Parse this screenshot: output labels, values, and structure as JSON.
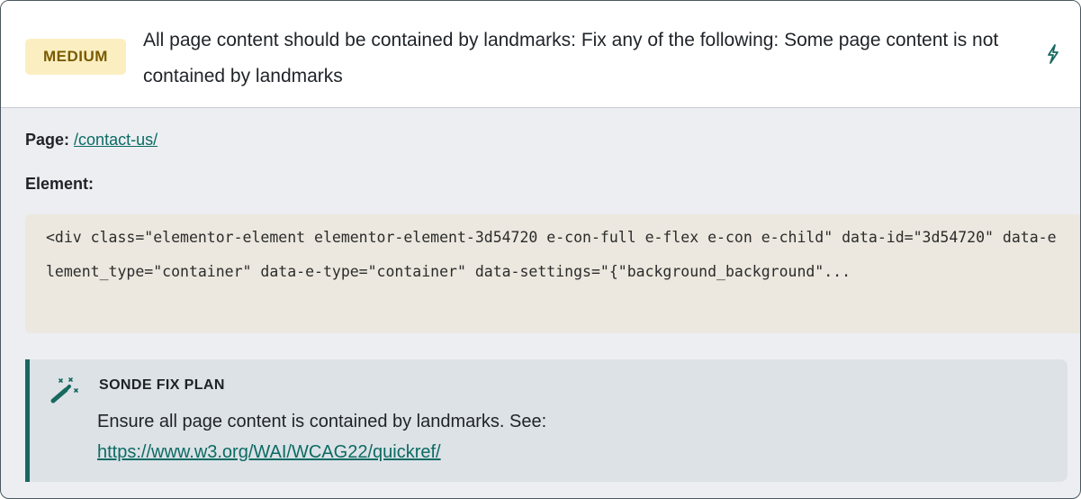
{
  "issue": {
    "severity": "MEDIUM",
    "title": "All page content should be contained by landmarks: Fix any of the following: Some page content is not contained by landmarks",
    "page_label": "Page:",
    "page_link": "/contact-us/",
    "element_label": "Element:",
    "element_code": "<div class=\"elementor-element elementor-element-3d54720 e-con-full e-flex e-con e-child\" data-id=\"3d54720\" data-element_type=\"container\" data-e-type=\"container\" data-settings=\"{\"background_background\"...",
    "fix_plan": {
      "title": "SONDE FIX PLAN",
      "text": "Ensure all page content is contained by landmarks. See:",
      "link": "https://www.w3.org/WAI/WCAG22/quickref/"
    }
  },
  "colors": {
    "accent": "#17695f",
    "badge_bg": "#fbefc2",
    "badge_text": "#7a5a00",
    "code_bg": "#ece8df",
    "panel_bg": "#eceef2"
  },
  "icons": {
    "header_action": "bolt-icon",
    "fix_plan": "magic-wand-icon"
  }
}
